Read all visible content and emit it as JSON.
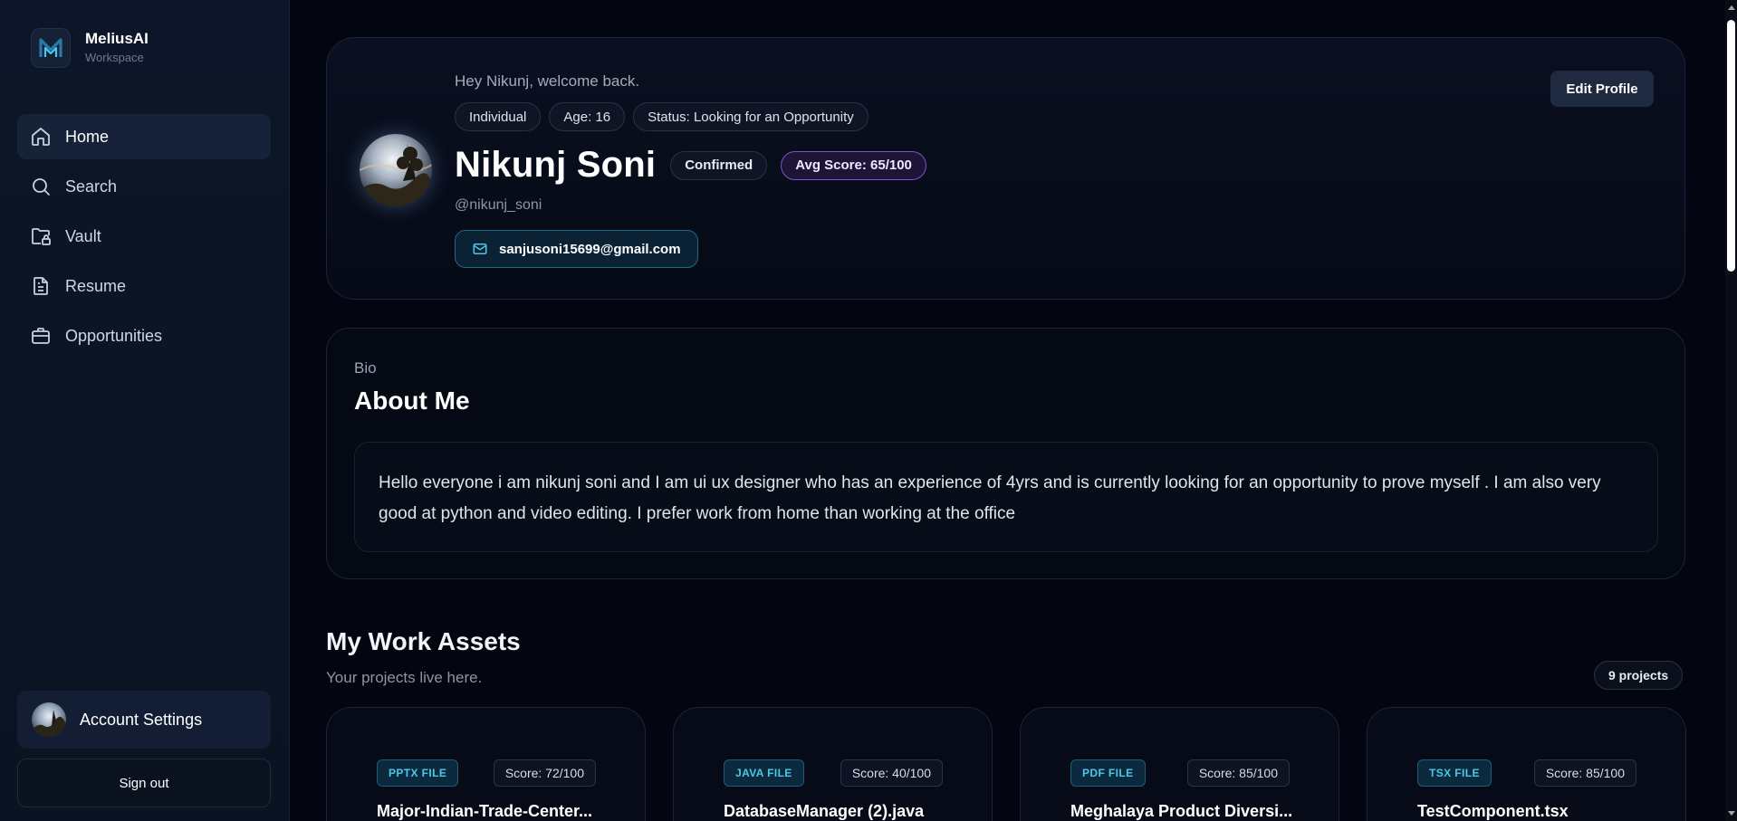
{
  "brand": {
    "name": "MeliusAI",
    "subtitle": "Workspace"
  },
  "sidebar": {
    "items": [
      {
        "label": "Home",
        "icon": "home-icon",
        "active": true
      },
      {
        "label": "Search",
        "icon": "search-icon",
        "active": false
      },
      {
        "label": "Vault",
        "icon": "folder-lock-icon",
        "active": false
      },
      {
        "label": "Resume",
        "icon": "document-icon",
        "active": false
      },
      {
        "label": "Opportunities",
        "icon": "briefcase-icon",
        "active": false
      }
    ],
    "account_label": "Account Settings",
    "signout_label": "Sign out"
  },
  "profile": {
    "greeting": "Hey Nikunj, welcome back.",
    "chips": [
      "Individual",
      "Age: 16",
      "Status: Looking for an Opportunity"
    ],
    "name": "Nikunj Soni",
    "status_badge": "Confirmed",
    "score_badge": "Avg Score: 65/100",
    "handle": "@nikunj_soni",
    "email": "sanjusoni15699@gmail.com",
    "edit_label": "Edit Profile"
  },
  "bio": {
    "label": "Bio",
    "title": "About Me",
    "text": "Hello everyone i am nikunj soni and I am ui ux designer who has an experience of 4yrs and is currently looking for an opportunity to prove myself . I am also very good at python and video editing. I prefer work from home than working at the office"
  },
  "assets": {
    "title": "My Work Assets",
    "subtitle": "Your projects live here.",
    "count_label": "9 projects",
    "items": [
      {
        "type": "PPTX FILE",
        "score": "Score: 72/100",
        "name": "Major-Indian-Trade-Center..."
      },
      {
        "type": "JAVA FILE",
        "score": "Score: 40/100",
        "name": "DatabaseManager (2).java"
      },
      {
        "type": "PDF FILE",
        "score": "Score: 85/100",
        "name": "Meghalaya Product Diversi..."
      },
      {
        "type": "TSX FILE",
        "score": "Score: 85/100",
        "name": "TestComponent.tsx"
      }
    ]
  },
  "colors": {
    "background": "#030510",
    "sidebar": "#0d1628",
    "accent_cyan": "#4cc7ea",
    "accent_purple": "#7a55c8"
  }
}
